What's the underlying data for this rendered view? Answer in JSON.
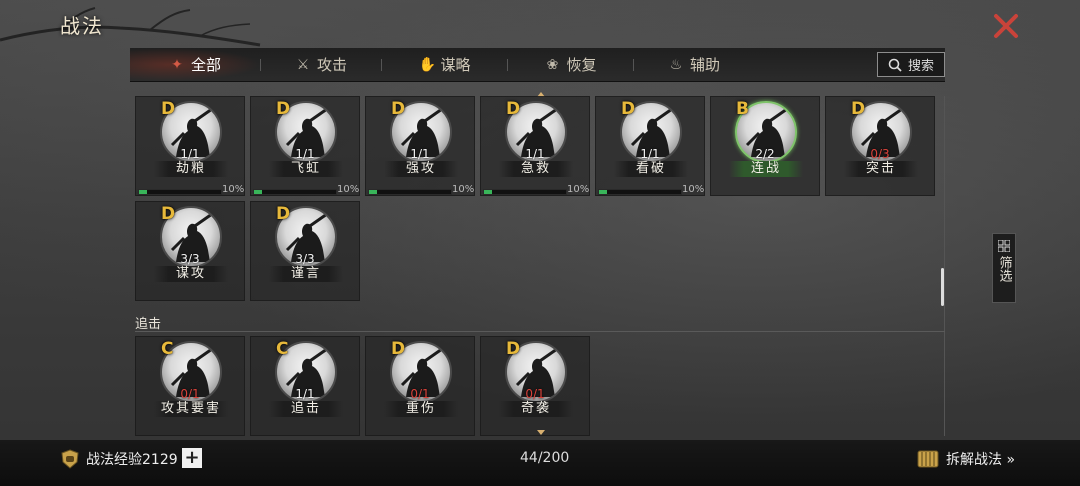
{
  "window": {
    "title": "战法"
  },
  "tabs": [
    {
      "label": "全部",
      "icon": "all-icon",
      "active": true
    },
    {
      "label": "攻击",
      "icon": "crossed-swords-icon",
      "active": false
    },
    {
      "label": "谋略",
      "icon": "strategy-hand-icon",
      "active": false
    },
    {
      "label": "恢复",
      "icon": "recovery-pot-icon",
      "active": false
    },
    {
      "label": "辅助",
      "icon": "support-bag-icon",
      "active": false
    }
  ],
  "search": {
    "label": "搜索"
  },
  "section_top": {
    "cards": [
      {
        "grade": "D",
        "count": "1/1",
        "name": "劫粮",
        "progress": "10%",
        "progress_value": 0.1
      },
      {
        "grade": "D",
        "count": "1/1",
        "name": "飞虹",
        "progress": "10%",
        "progress_value": 0.1
      },
      {
        "grade": "D",
        "count": "1/1",
        "name": "强攻",
        "progress": "10%",
        "progress_value": 0.1
      },
      {
        "grade": "D",
        "count": "1/1",
        "name": "急救",
        "progress": "10%",
        "progress_value": 0.1
      },
      {
        "grade": "D",
        "count": "1/1",
        "name": "看破",
        "progress": "10%",
        "progress_value": 0.1
      },
      {
        "grade": "B",
        "count": "2/2",
        "name": "连战"
      },
      {
        "grade": "D",
        "count": "0/3",
        "name": "突击",
        "count_red": true
      },
      {
        "grade": "D",
        "count": "3/3",
        "name": "谋攻"
      },
      {
        "grade": "D",
        "count": "3/3",
        "name": "谨言"
      }
    ]
  },
  "section_pursuit": {
    "label": "追击",
    "cards": [
      {
        "grade": "C",
        "count": "0/1",
        "name": "攻其要害",
        "count_red": true
      },
      {
        "grade": "C",
        "count": "1/1",
        "name": "追击"
      },
      {
        "grade": "D",
        "count": "0/1",
        "name": "重伤",
        "count_red": true
      },
      {
        "grade": "D",
        "count": "0/1",
        "name": "奇袭",
        "count_red": true
      }
    ]
  },
  "filter": {
    "label": "筛选"
  },
  "footer": {
    "exp_label": "战法经验2129",
    "plus": "+",
    "capacity": "44/200",
    "disassemble": "拆解战法 »"
  },
  "colors": {
    "grade": "#e7b93b",
    "progress": "#39b55a",
    "count_red": "#d9423a",
    "close": "#c9433a"
  }
}
